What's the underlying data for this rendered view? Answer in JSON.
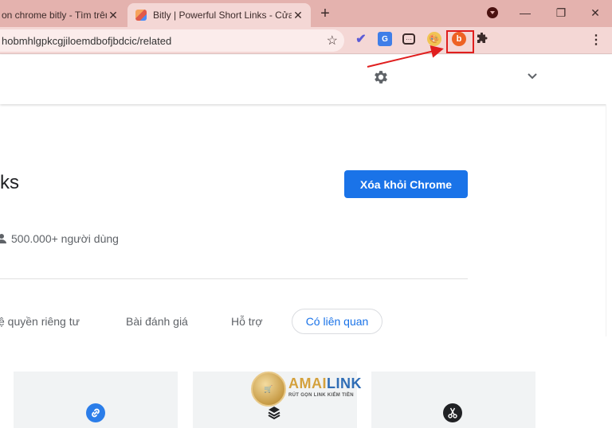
{
  "browser": {
    "tabs": [
      {
        "title": "on chrome bitly - Tìm trên",
        "close": "✕"
      },
      {
        "title": "Bitly | Powerful Short Links - Cửa",
        "close": "✕"
      }
    ],
    "new_tab": "+",
    "window_controls": {
      "minimize": "—",
      "restore": "❐",
      "close": "✕"
    }
  },
  "toolbar": {
    "url": "hobmhlgpkcgjiloemdbofjbdcic/related",
    "extensions": [
      "check-extension",
      "translate-extension",
      "chat-extension",
      "palette-extension",
      "bitly-extension",
      "puzzle-extensions"
    ],
    "highlight_color": "#e01e1e"
  },
  "page": {
    "title": "ks",
    "remove_button": "Xóa khỏi Chrome",
    "users": "500.000+ người dùng",
    "nav_tabs": [
      {
        "label": "ệ quyền riêng tư"
      },
      {
        "label": "Bài đánh giá"
      },
      {
        "label": "Hỗ trợ"
      },
      {
        "label": "Có liên quan",
        "active": true
      }
    ],
    "accent_color": "#1a73e8"
  },
  "watermark": {
    "brand_a": "AMAI",
    "brand_b": "LINK",
    "tagline": "RÚT GỌN LINK KIẾM TIỀN"
  }
}
